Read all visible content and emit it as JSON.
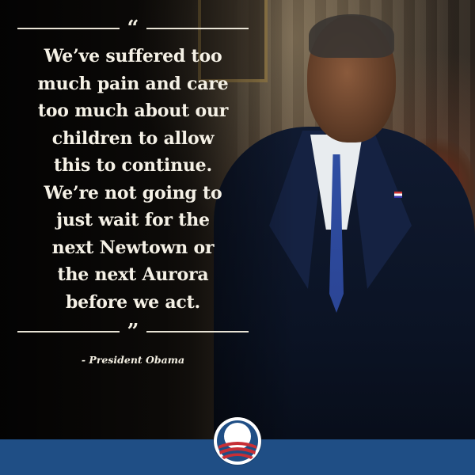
{
  "quote": {
    "open_mark": "“",
    "lines": [
      "We’ve suffered too",
      "much pain and care",
      "too much about our",
      "children to allow",
      "this to continue.",
      "We’re not going to",
      "just wait for the",
      "next Newtown or",
      "the next Aurora",
      "before we act."
    ],
    "close_mark": "”",
    "attribution": "- President Obama"
  },
  "colors": {
    "footer_bar": "#1f4e85",
    "logo_blue": "#1f4e85",
    "logo_red": "#c62f36",
    "text": "#f5f1e6"
  },
  "icons": {
    "logo": "campaign-logo-icon"
  }
}
